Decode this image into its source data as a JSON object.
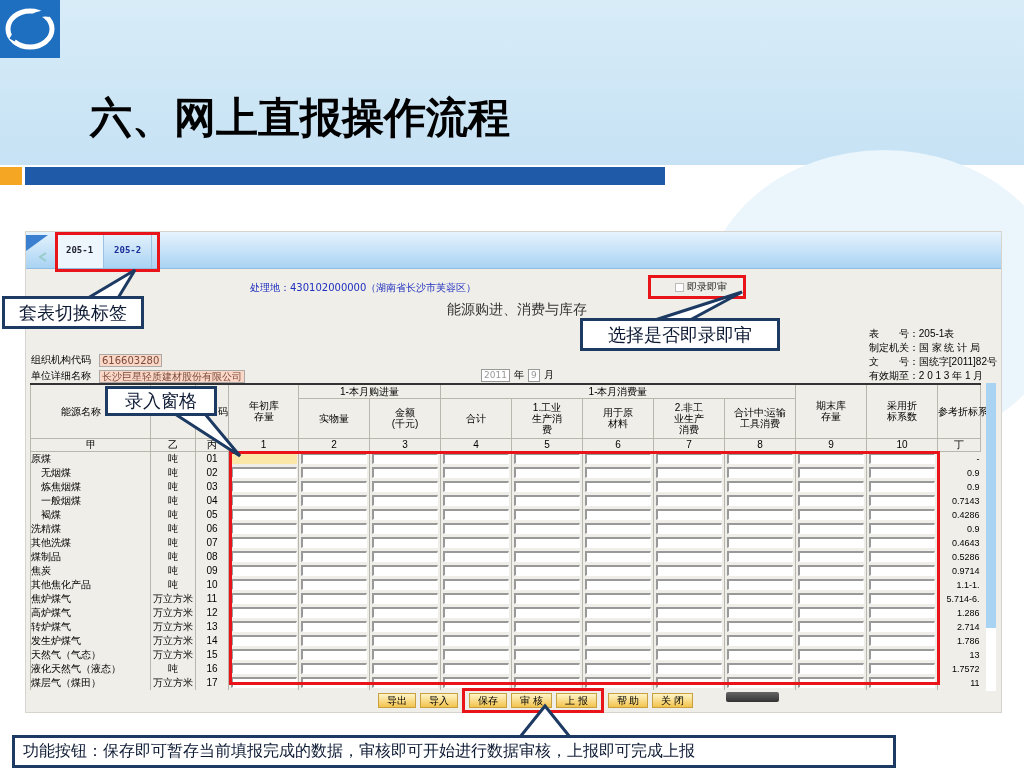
{
  "slide": {
    "title": "六、网上直报操作流程"
  },
  "app": {
    "tabs": [
      {
        "label": "205-1",
        "selected": true
      },
      {
        "label": "205-2",
        "selected": false
      }
    ],
    "location": "处理地：430102000000（湖南省长沙市芙蓉区）",
    "instant_review": {
      "label": "即录即审",
      "checked": false
    },
    "form_title": "能源购进、消费与库存",
    "meta": [
      "表　　号：205-1表",
      "制定机关：国 家 统 计 局",
      "文　　号：国统字[2011]82号",
      "有效期至：2 0 1 3 年 1 月"
    ],
    "fields": [
      {
        "label": "组织机构代码",
        "value": "616603280"
      },
      {
        "label": "单位详细名称",
        "value": "长沙巨星轻质建材股份有限公司"
      }
    ],
    "period": {
      "year": "2011",
      "year_label": "年",
      "month": "9",
      "month_label": "月"
    },
    "table": {
      "name_header": "能源名称",
      "code_header": "码",
      "stock_start": "年初库存量",
      "purchase": {
        "label": "1-本月购进量",
        "columns": [
          "实物量",
          "金额(千元)"
        ]
      },
      "consumption": {
        "label": "1-本月消费量",
        "columns": [
          "合计",
          "1.工业生产消费",
          "用于原材料",
          "2.非工业生产消费",
          "合计中:运输工具消费"
        ]
      },
      "stock_end": "期末库存量",
      "factor": "采用折标系数",
      "reference": "参考折标系",
      "index_row": [
        "甲",
        "乙",
        "丙",
        "1",
        "2",
        "3",
        "4",
        "5",
        "6",
        "7",
        "8",
        "9",
        "10",
        "丁"
      ],
      "rows": [
        {
          "name": "原煤",
          "unit": "吨",
          "code": "01",
          "reference": "-",
          "focused": true,
          "children": [
            {
              "name": "无烟煤",
              "unit": "吨",
              "code": "02",
              "reference": "0.9",
              "focused": false
            },
            {
              "name": "炼焦烟煤",
              "unit": "吨",
              "code": "03",
              "reference": "0.9",
              "focused": false
            },
            {
              "name": "一般烟煤",
              "unit": "吨",
              "code": "04",
              "reference": "0.7143",
              "focused": false
            },
            {
              "name": "褐煤",
              "unit": "吨",
              "code": "05",
              "reference": "0.4286",
              "focused": false
            }
          ]
        },
        {
          "name": "洗精煤",
          "unit": "吨",
          "code": "06",
          "reference": "0.9",
          "focused": false
        },
        {
          "name": "其他洗煤",
          "unit": "吨",
          "code": "07",
          "reference": "0.4643",
          "focused": false
        },
        {
          "name": "煤制品",
          "unit": "吨",
          "code": "08",
          "reference": "0.5286",
          "focused": false
        },
        {
          "name": "焦炭",
          "unit": "吨",
          "code": "09",
          "reference": "0.9714",
          "focused": false
        },
        {
          "name": "其他焦化产品",
          "unit": "吨",
          "code": "10",
          "reference": "1.1-1.",
          "focused": false
        },
        {
          "name": "焦炉煤气",
          "unit": "万立方米",
          "code": "11",
          "reference": "5.714-6.",
          "focused": false
        },
        {
          "name": "高炉煤气",
          "unit": "万立方米",
          "code": "12",
          "reference": "1.286",
          "focused": false
        },
        {
          "name": "转炉煤气",
          "unit": "万立方米",
          "code": "13",
          "reference": "2.714",
          "focused": false
        },
        {
          "name": "发生炉煤气",
          "unit": "万立方米",
          "code": "14",
          "reference": "1.786",
          "focused": false
        },
        {
          "name": "天然气（气态）",
          "unit": "万立方米",
          "code": "15",
          "reference": "13",
          "focused": false
        },
        {
          "name": "液化天然气（液态）",
          "unit": "吨",
          "code": "16",
          "reference": "1.7572",
          "focused": false
        },
        {
          "name": "煤层气（煤田）",
          "unit": "万立方米",
          "code": "17",
          "reference": "11",
          "focused": false
        }
      ]
    },
    "buttons": [
      "导出",
      "导入",
      "保存",
      "审 核",
      "上 报",
      "帮 助",
      "关 闭"
    ]
  },
  "callouts": [
    {
      "text": "套表切换标签"
    },
    {
      "text": "选择是否即录即审"
    },
    {
      "text": "录入窗格"
    },
    {
      "text": "功能按钮：保存即可暂存当前填报完成的数据，审核即可开始进行数据审核，上报即可完成上报"
    }
  ]
}
